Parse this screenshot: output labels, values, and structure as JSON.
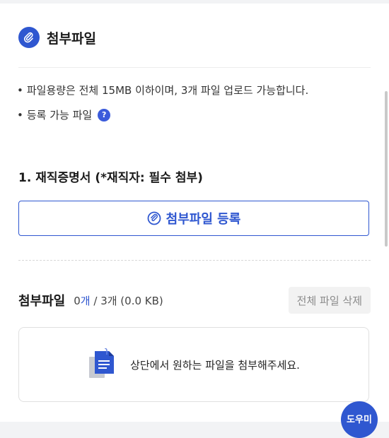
{
  "section": {
    "title": "첨부파일",
    "icon": "paperclip-icon"
  },
  "notices": [
    "파일용량은 전체 15MB 이하이며, 3개 파일 업로드 가능합니다.",
    "등록 가능 파일"
  ],
  "help_badge": "?",
  "bullet": "•",
  "document": {
    "heading": "1. 재직증명서 (*재직자: 필수 첨부)",
    "attach_button_label": "첨부파일 등록"
  },
  "attached": {
    "title": "첨부파일",
    "count_current": "0",
    "count_unit": "개",
    "count_rest": " / 3개 (0.0 KB)",
    "delete_all_label": "전체 파일 삭제"
  },
  "dropzone": {
    "message": "상단에서 원하는 파일을 첨부해주세요."
  },
  "fab": {
    "label": "도우미"
  },
  "colors": {
    "accent": "#2f57d0",
    "background": "#f2f3f5"
  }
}
